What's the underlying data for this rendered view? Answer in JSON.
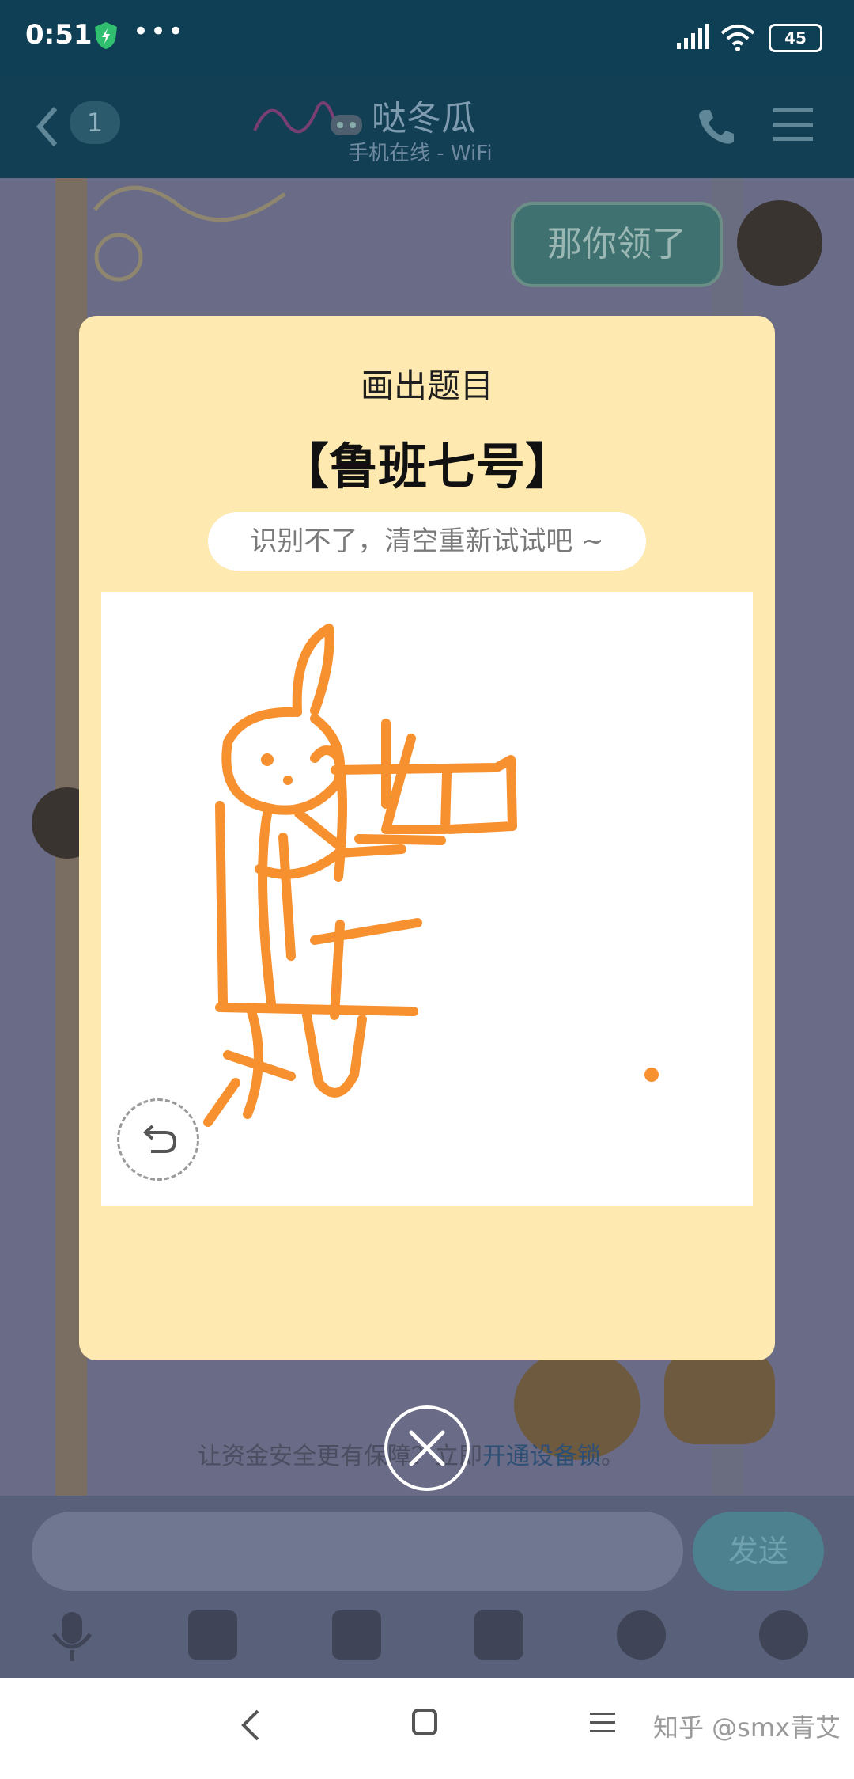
{
  "status_bar": {
    "time": "0:51",
    "dots": "•••",
    "battery": "45"
  },
  "chat_header": {
    "unread_count": "1",
    "contact_name": "哒冬瓜",
    "contact_status": "手机在线 - WiFi"
  },
  "messages": {
    "last_sent": "那你领了"
  },
  "notice": {
    "prefix": "让资金安全更有保障？立即",
    "link": "开通设备锁",
    "suffix": "。"
  },
  "input_bar": {
    "send_label": "发送"
  },
  "modal": {
    "title": "画出题目",
    "topic": "【鲁班七号】",
    "hint": "识别不了，清空重新试试吧 ~"
  },
  "watermark": "知乎 @smx青艾",
  "colors": {
    "modal_bg": "#fee9b0",
    "stroke": "#f7902f",
    "canvas_bg": "#ffffff"
  }
}
